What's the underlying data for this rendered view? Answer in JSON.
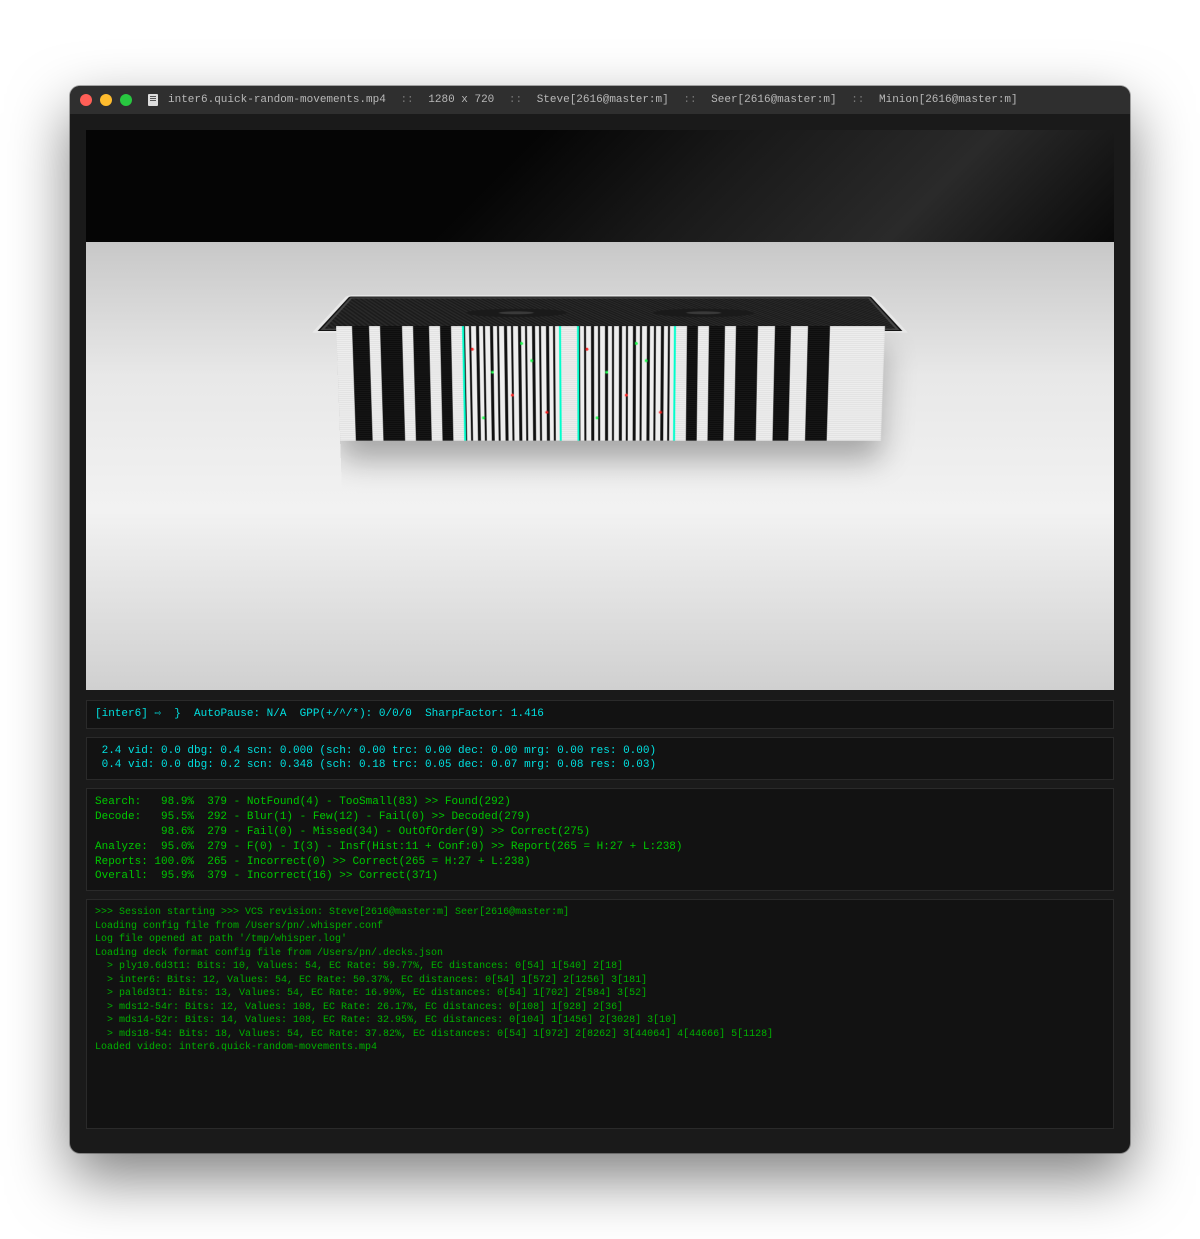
{
  "titlebar": {
    "filename": "inter6.quick-random-movements.mp4",
    "dimensions": "1280 x 720",
    "proc1": "Steve[2616@master:m]",
    "proc2": "Seer[2616@master:m]",
    "proc3": "Minion[2616@master:m]",
    "separator": "::"
  },
  "status_top": "[inter6] ⇨  }  AutoPause: N/A  GPP(+/^/*): 0/0/0  SharpFactor: 1.416",
  "timing": {
    "line1": " 2.4 vid: 0.0 dbg: 0.4 scn: 0.000 (sch: 0.00 trc: 0.00 dec: 0.00 mrg: 0.00 res: 0.00)",
    "line2": " 0.4 vid: 0.0 dbg: 0.2 scn: 0.348 (sch: 0.18 trc: 0.05 dec: 0.07 mrg: 0.08 res: 0.03)"
  },
  "stats": {
    "search": "Search:   98.9%  379 - NotFound(4) - TooSmall(83) >> Found(292)",
    "decode": "Decode:   95.5%  292 - Blur(1) - Few(12) - Fail(0) >> Decoded(279)",
    "decode2": "          98.6%  279 - Fail(0) - Missed(34) - OutOfOrder(9) >> Correct(275)",
    "analyze": "Analyze:  95.0%  279 - F(0) - I(3) - Insf(Hist:11 + Conf:0) >> Report(265 = H:27 + L:238)",
    "reports": "Reports: 100.0%  265 - Incorrect(0) >> Correct(265 = H:27 + L:238)",
    "overall": "Overall:  95.9%  379 - Incorrect(16) >> Correct(371)"
  },
  "log": {
    "l1": ">>> Session starting >>> VCS revision: Steve[2616@master:m] Seer[2616@master:m]",
    "l2": "Loading config file from /Users/pn/.whisper.conf",
    "l3": "Log file opened at path '/tmp/whisper.log'",
    "l4": "Loading deck format config file from /Users/pn/.decks.json",
    "l5": "  > ply10.6d3t1: Bits: 10, Values: 54, EC Rate: 59.77%, EC distances: 0[54] 1[540] 2[18]",
    "l6": "  > inter6: Bits: 12, Values: 54, EC Rate: 50.37%, EC distances: 0[54] 1[572] 2[1256] 3[181]",
    "l7": "  > pal6d3t1: Bits: 13, Values: 54, EC Rate: 16.99%, EC distances: 0[54] 1[702] 2[584] 3[52]",
    "l8": "  > mds12-54r: Bits: 12, Values: 108, EC Rate: 26.17%, EC distances: 0[108] 1[928] 2[36]",
    "l9": "  > mds14-52r: Bits: 14, Values: 108, EC Rate: 32.95%, EC distances: 0[104] 1[1456] 2[3028] 3[10]",
    "l10": "  > mds18-54: Bits: 18, Values: 54, EC Rate: 37.82%, EC distances: 0[54] 1[972] 2[8262] 3[44064] 4[44666] 5[1128]",
    "l11": "Loaded video: inter6.quick-random-movements.mp4"
  }
}
